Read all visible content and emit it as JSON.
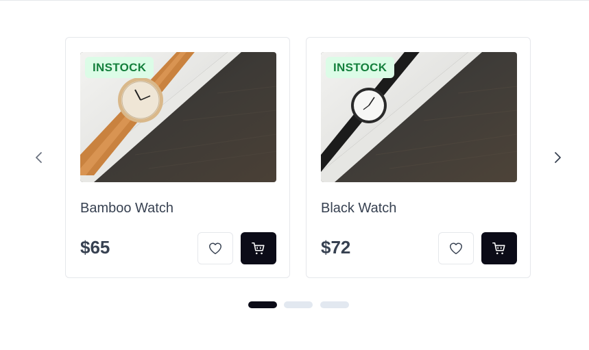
{
  "carousel": {
    "prev_icon": "chevron-left-icon",
    "next_icon": "chevron-right-icon",
    "products": [
      {
        "badge": "INSTOCK",
        "name": "Bamboo Watch",
        "price": "$65",
        "favorite_icon": "heart-icon",
        "cart_icon": "shopping-cart-icon"
      },
      {
        "badge": "INSTOCK",
        "name": "Black Watch",
        "price": "$72",
        "favorite_icon": "heart-icon",
        "cart_icon": "shopping-cart-icon"
      }
    ],
    "page_count": 3,
    "active_page": 1
  },
  "colors": {
    "badge_bg": "#dcfce7",
    "badge_text": "#15803d",
    "cart_button": "#0b0b17",
    "dot_active": "#0b0b17",
    "dot_inactive": "#e2e8f0"
  }
}
